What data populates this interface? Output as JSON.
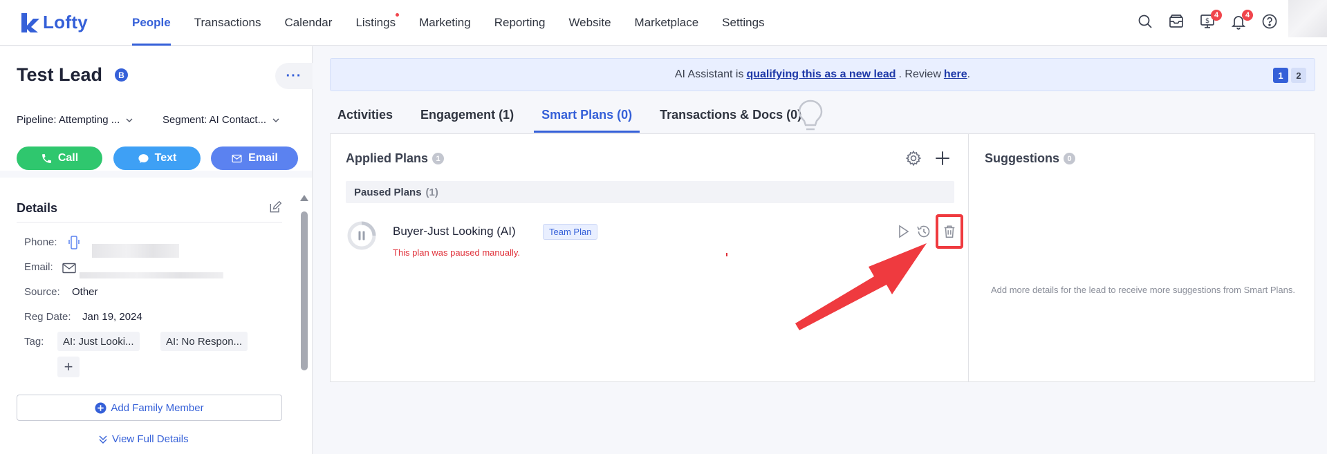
{
  "app": {
    "logo_text": "Lofty",
    "brand_color": "#3560d8"
  },
  "nav": {
    "items": [
      {
        "label": "People",
        "active": true
      },
      {
        "label": "Transactions"
      },
      {
        "label": "Calendar"
      },
      {
        "label": "Listings",
        "dot": true
      },
      {
        "label": "Marketing"
      },
      {
        "label": "Reporting"
      },
      {
        "label": "Website"
      },
      {
        "label": "Marketplace"
      },
      {
        "label": "Settings"
      }
    ],
    "icons": [
      {
        "name": "search-icon"
      },
      {
        "name": "inbox-icon"
      },
      {
        "name": "dollar-monitor-icon",
        "badge": "4"
      },
      {
        "name": "bell-icon",
        "badge": "4"
      },
      {
        "name": "help-icon"
      }
    ]
  },
  "lead": {
    "name": "Test Lead",
    "badge": "B",
    "pipeline": "Pipeline: Attempting ...",
    "segment": "Segment: AI Contact...",
    "actions": {
      "call": "Call",
      "text": "Text",
      "email": "Email"
    },
    "details": {
      "title": "Details",
      "phone_label": "Phone:",
      "email_label": "Email:",
      "source_label": "Source:",
      "source_value": "Other",
      "reg_label": "Reg Date:",
      "reg_value": "Jan 19, 2024",
      "tag_label": "Tag:",
      "tags": [
        "AI: Just Looki...",
        "AI: No Respon..."
      ],
      "tag_add": "+"
    },
    "add_family": "Add Family Member",
    "view_full": "View Full Details"
  },
  "ai_banner": {
    "prefix": "AI Assistant is",
    "link": "qualifying this as a new lead",
    "middle": ". Review",
    "here": "here",
    "suffix": ".",
    "pages": [
      "1",
      "2"
    ]
  },
  "tabs": [
    {
      "label": "Activities"
    },
    {
      "label": "Engagement (1)"
    },
    {
      "label": "Smart Plans (0)",
      "active": true
    },
    {
      "label": "Transactions & Docs (0)"
    }
  ],
  "applied": {
    "title": "Applied Plans",
    "count": "1",
    "paused_label": "Paused Plans",
    "paused_count": "(1)",
    "plan": {
      "name": "Buyer-Just Looking (AI)",
      "tag": "Team Plan",
      "message": "This plan was paused manually."
    }
  },
  "suggestions": {
    "title": "Suggestions",
    "count": "0",
    "empty": "Add more details for the lead to receive more suggestions from Smart Plans."
  },
  "colors": {
    "call": "#2fc76e",
    "text": "#3ea0f5",
    "email": "#5b82f0",
    "highlight": "#ef3a3f"
  }
}
